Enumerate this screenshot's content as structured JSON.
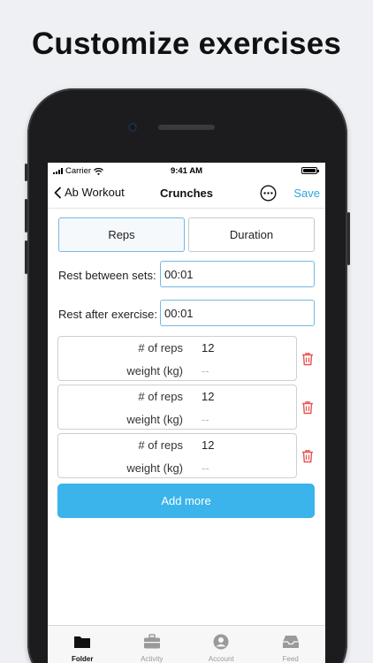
{
  "headline": "Customize exercises",
  "status_bar": {
    "carrier": "Carrier",
    "time": "9:41 AM"
  },
  "nav": {
    "back_label": "Ab Workout",
    "title": "Crunches",
    "save_label": "Save"
  },
  "segments": [
    {
      "label": "Reps",
      "active": true
    },
    {
      "label": "Duration",
      "active": false
    }
  ],
  "rest_between_sets": {
    "label": "Rest between sets:",
    "value": "00:01"
  },
  "rest_after_exercise": {
    "label": "Rest after exercise:",
    "value": "00:01"
  },
  "sets": [
    {
      "reps_label": "# of reps",
      "reps_value": "12",
      "weight_label": "weight (kg)",
      "weight_placeholder": "--"
    },
    {
      "reps_label": "# of reps",
      "reps_value": "12",
      "weight_label": "weight (kg)",
      "weight_placeholder": "--"
    },
    {
      "reps_label": "# of reps",
      "reps_value": "12",
      "weight_label": "weight (kg)",
      "weight_placeholder": "--"
    }
  ],
  "add_more_label": "Add more",
  "tabbar": [
    {
      "label": "Folder",
      "icon": "folder-icon",
      "active": true
    },
    {
      "label": "Activity",
      "icon": "briefcase-icon",
      "active": false
    },
    {
      "label": "Account",
      "icon": "user-icon",
      "active": false
    },
    {
      "label": "Feed",
      "icon": "inbox-icon",
      "active": false
    }
  ],
  "colors": {
    "accent": "#3bb3eb",
    "input_border": "#74b8e4",
    "delete_red": "#e8524f",
    "headline_text": "#111111",
    "background": "#eef0f3"
  }
}
